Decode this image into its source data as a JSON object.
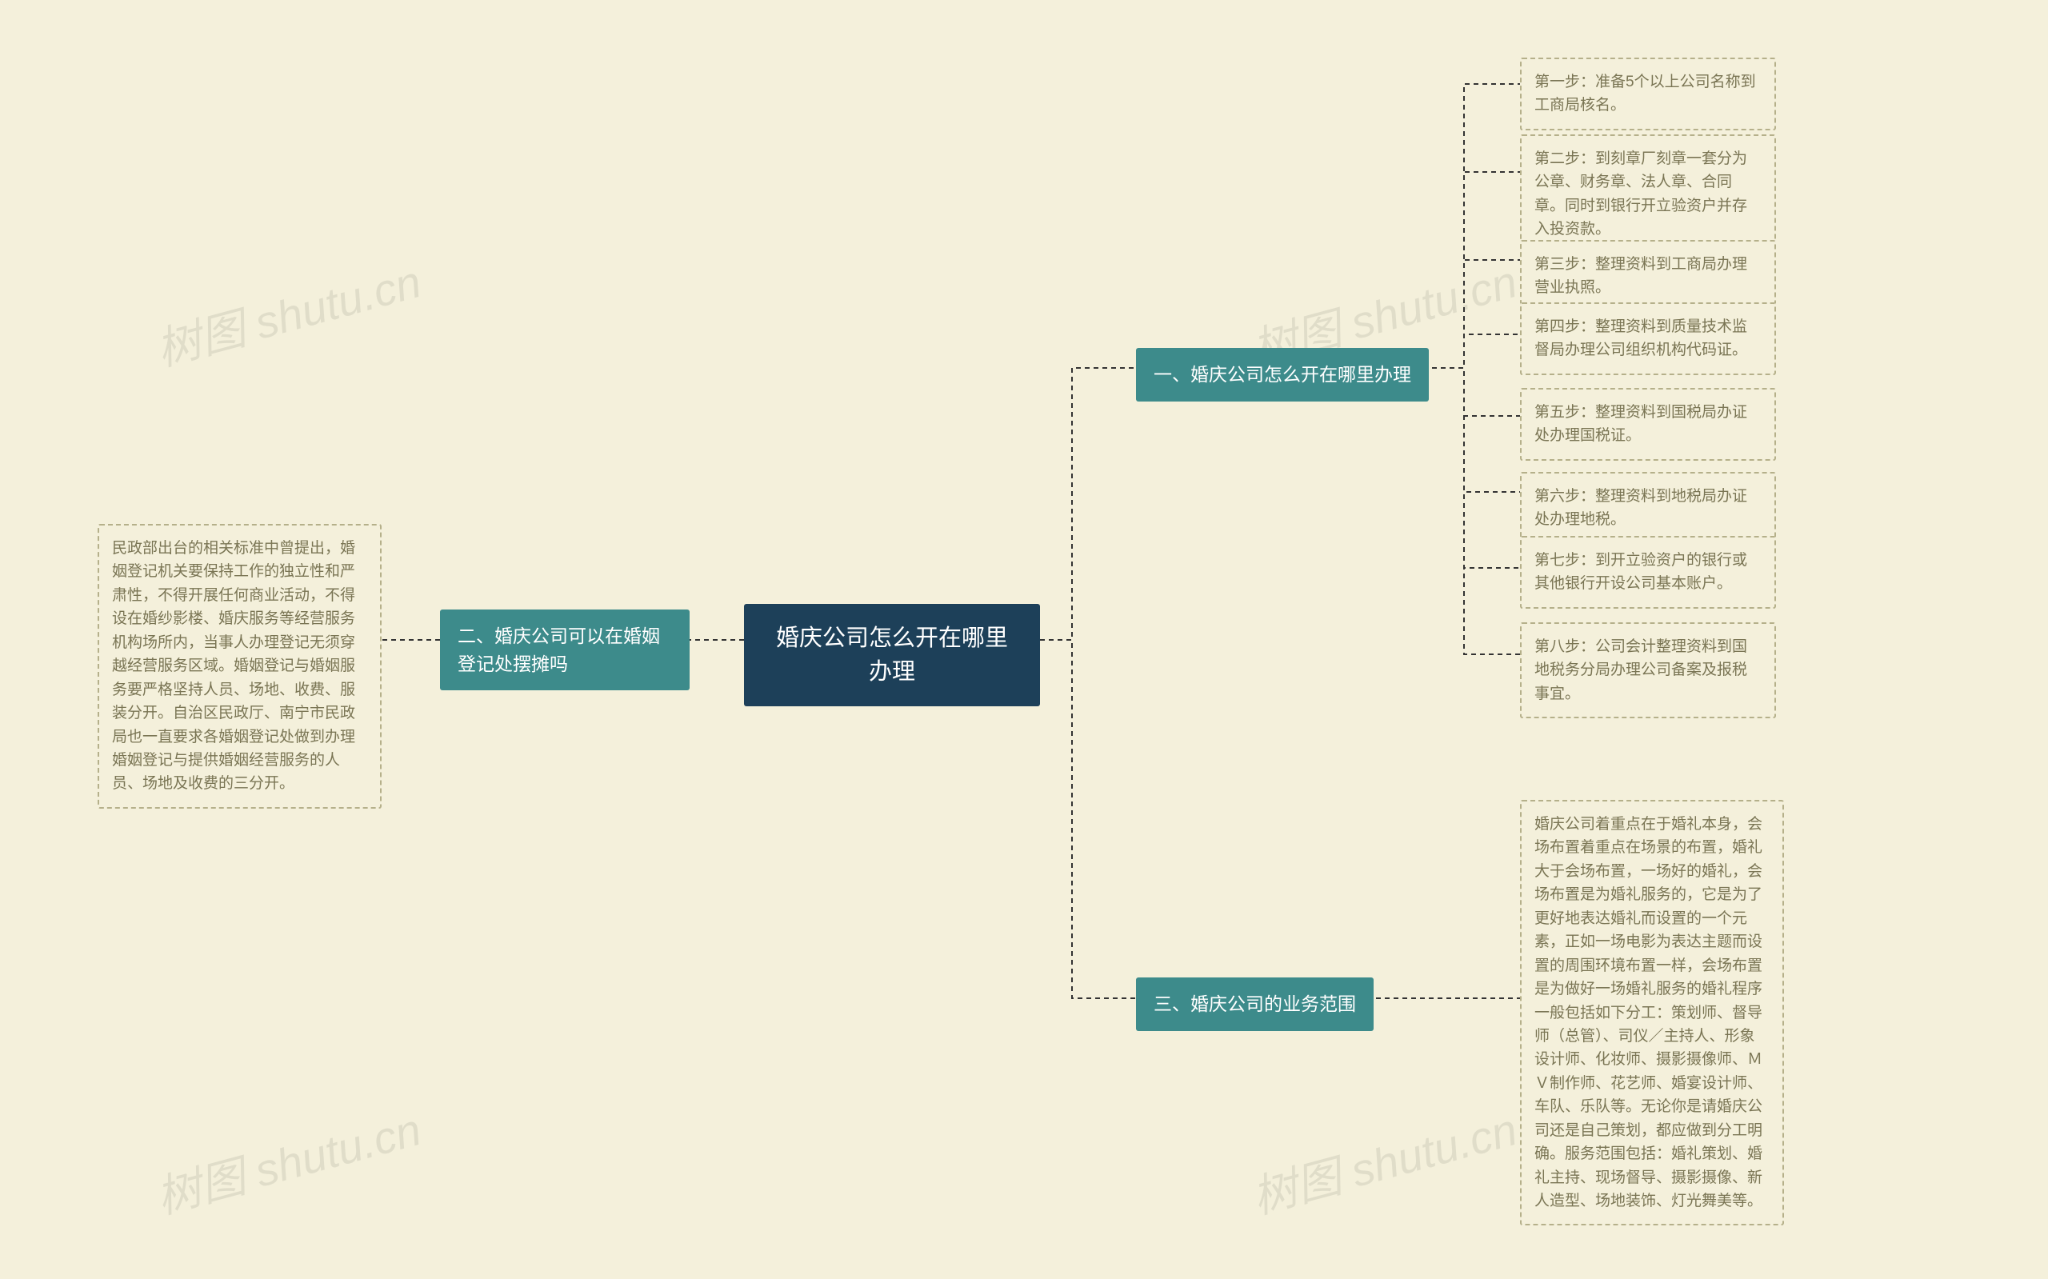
{
  "watermark": "树图 shutu.cn",
  "center": {
    "title": "婚庆公司怎么开在哪里办理"
  },
  "branch1": {
    "title": "一、婚庆公司怎么开在哪里办理",
    "steps": [
      "第一步：准备5个以上公司名称到工商局核名。",
      "第二步：到刻章厂刻章一套分为公章、财务章、法人章、合同章。同时到银行开立验资户并存入投资款。",
      "第三步：整理资料到工商局办理营业执照。",
      "第四步：整理资料到质量技术监督局办理公司组织机构代码证。",
      "第五步：整理资料到国税局办证处办理国税证。",
      "第六步：整理资料到地税局办证处办理地税。",
      "第七步：到开立验资户的银行或其他银行开设公司基本账户。",
      "第八步：公司会计整理资料到国地税务分局办理公司备案及报税事宜。"
    ]
  },
  "branch2": {
    "title": "二、婚庆公司可以在婚姻登记处摆摊吗",
    "detail": "民政部出台的相关标准中曾提出，婚姻登记机关要保持工作的独立性和严肃性，不得开展任何商业活动，不得设在婚纱影楼、婚庆服务等经营服务机构场所内，当事人办理登记无须穿越经营服务区域。婚姻登记与婚姻服务要严格坚持人员、场地、收费、服装分开。自治区民政厅、南宁市民政局也一直要求各婚姻登记处做到办理婚姻登记与提供婚姻经营服务的人员、场地及收费的三分开。"
  },
  "branch3": {
    "title": "三、婚庆公司的业务范围",
    "detail": "婚庆公司着重点在于婚礼本身，会场布置着重点在场景的布置，婚礼大于会场布置，一场好的婚礼，会场布置是为婚礼服务的，它是为了更好地表达婚礼而设置的一个元素，正如一场电影为表达主题而设置的周围环境布置一样，会场布置是为做好一场婚礼服务的婚礼程序一般包括如下分工：策划师、督导师（总管）、司仪／主持人、形象设计师、化妆师、摄影摄像师、ＭＶ制作师、花艺师、婚宴设计师、车队、乐队等。无论你是请婚庆公司还是自己策划，都应做到分工明确。服务范围包括：婚礼策划、婚礼主持、现场督导、摄影摄像、新人造型、场地装饰、灯光舞美等。"
  }
}
